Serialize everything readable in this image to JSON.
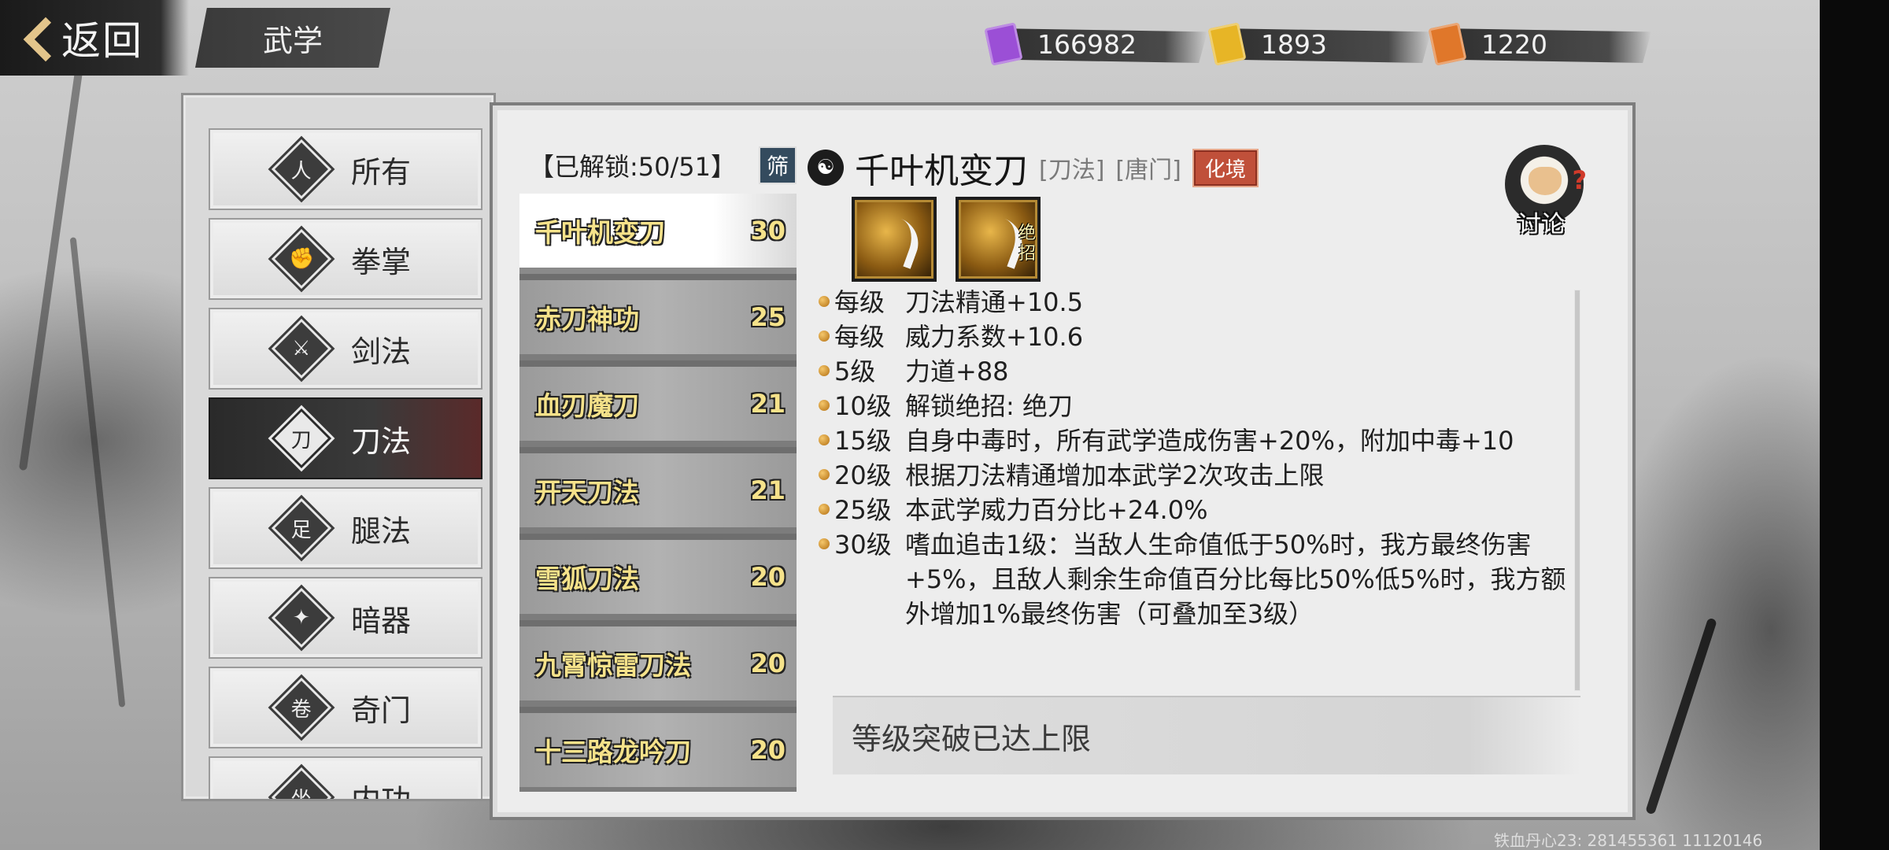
{
  "header": {
    "back_label": "返回",
    "page_title": "武学"
  },
  "currencies": [
    {
      "icon": "purple-scroll-icon",
      "color": "#9b4fd6",
      "value": "166982"
    },
    {
      "icon": "gold-scroll-icon",
      "color": "#e7b526",
      "value": "1893"
    },
    {
      "icon": "orange-scroll-icon",
      "color": "#e0772a",
      "value": "1220"
    }
  ],
  "categories": [
    {
      "label": "所有",
      "icon": "figure-icon"
    },
    {
      "label": "拳掌",
      "icon": "fist-icon"
    },
    {
      "label": "剑法",
      "icon": "sword-icon"
    },
    {
      "label": "刀法",
      "icon": "blade-icon",
      "active": true
    },
    {
      "label": "腿法",
      "icon": "leg-icon"
    },
    {
      "label": "暗器",
      "icon": "shuriken-icon"
    },
    {
      "label": "奇门",
      "icon": "scroll-icon"
    },
    {
      "label": "内功",
      "icon": "meditation-icon"
    }
  ],
  "skill_list": {
    "unlocked_label": "【已解锁:50/51】",
    "filter_label": "筛",
    "items": [
      {
        "name": "千叶机变刀",
        "level": "30",
        "active": true
      },
      {
        "name": "赤刀神功",
        "level": "25"
      },
      {
        "name": "血刃魔刀",
        "level": "21"
      },
      {
        "name": "开天刀法",
        "level": "21"
      },
      {
        "name": "雪狐刀法",
        "level": "20"
      },
      {
        "name": "九霄惊雷刀法",
        "level": "20"
      },
      {
        "name": "十三路龙吟刀",
        "level": "20"
      }
    ]
  },
  "detail": {
    "name": "千叶机变刀",
    "type_tag": "[刀法]",
    "school_tag": "[唐门]",
    "realm_badge": "化境",
    "discuss_label": "讨论",
    "ult_label": "绝招",
    "effects": [
      {
        "level": "每级",
        "desc": "刀法精通+10.5"
      },
      {
        "level": "每级",
        "desc": "威力系数+10.6"
      },
      {
        "level": "5级",
        "desc": "力道+88"
      },
      {
        "level": "10级",
        "desc": "解锁绝招:  绝刀"
      },
      {
        "level": "15级",
        "desc": "自身中毒时，所有武学造成伤害+20%，附加中毒+10"
      },
      {
        "level": "20级",
        "desc": "根据刀法精通增加本武学2次攻击上限"
      },
      {
        "level": "25级",
        "desc": "本武学威力百分比+24.0%"
      },
      {
        "level": "30级",
        "desc": "嗜血追击1级：当敌人生命值低于50%时，我方最终伤害+5%，且敌人剩余生命值百分比每比50%低5%时，我方额外增加1%最终伤害（可叠加至3级）"
      }
    ],
    "limit_text": "等级突破已达上限"
  },
  "footer_id": "铁血丹心23: 281455361  11120146"
}
